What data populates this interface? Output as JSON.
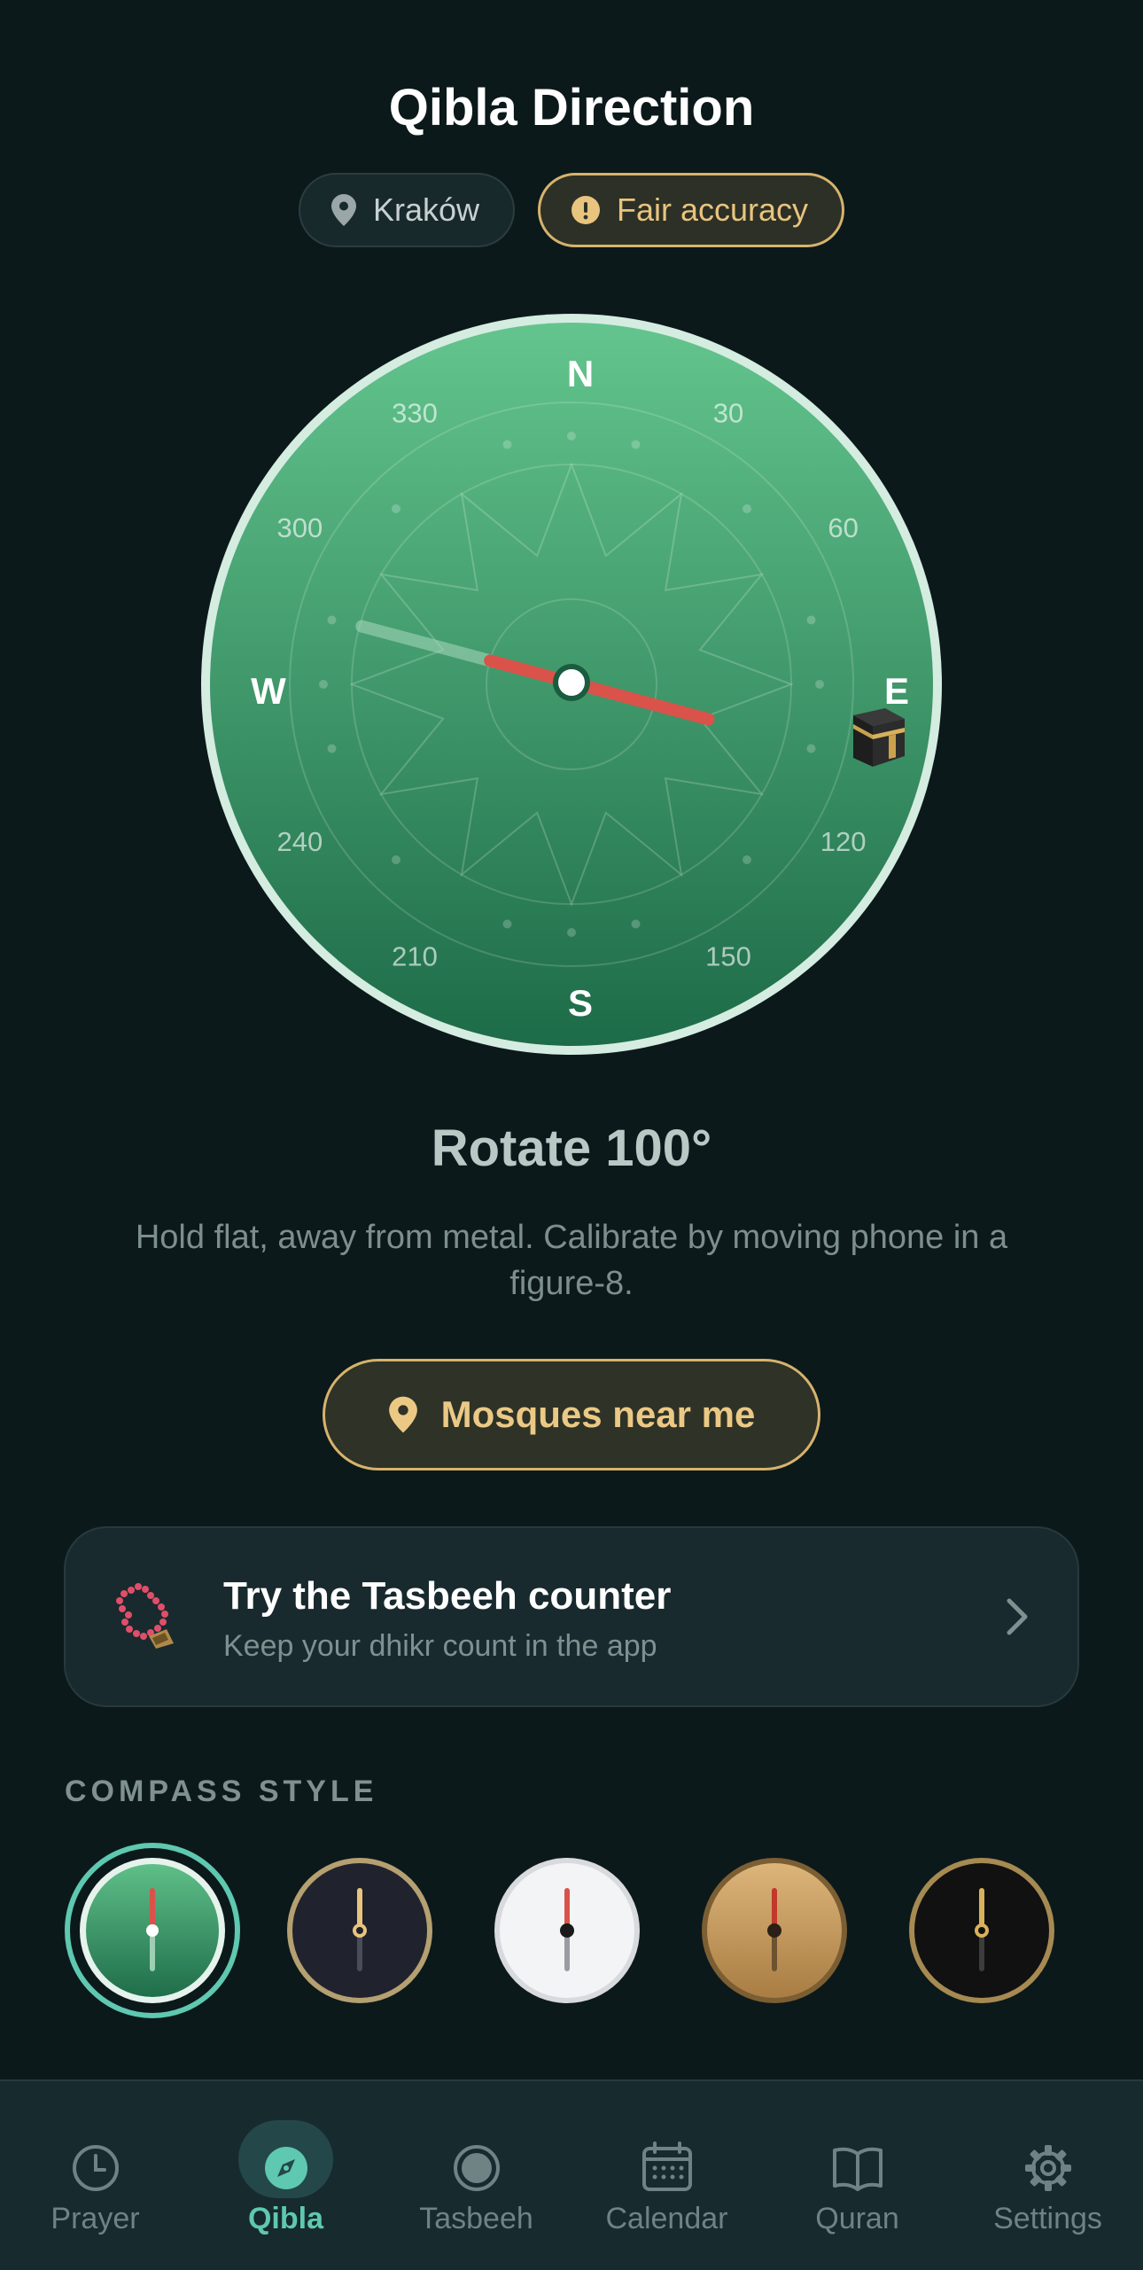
{
  "header": {
    "title": "Qibla Direction",
    "location_chip": "Kraków",
    "accuracy_chip": "Fair accuracy"
  },
  "compass": {
    "cardinals": {
      "n": "N",
      "e": "E",
      "s": "S",
      "w": "W"
    },
    "degree_labels": [
      "30",
      "60",
      "120",
      "150",
      "210",
      "240",
      "300",
      "330"
    ],
    "needle_heading_deg": 105,
    "qibla_marker_icon": "kaaba-icon",
    "colors": {
      "face_top": "#62c48c",
      "face_bottom": "#1f6e4a",
      "rim": "#d5ece1",
      "needle": "#d9534a"
    }
  },
  "instruction": {
    "rotate": "Rotate 100°",
    "hint": "Hold flat, away from metal. Calibrate by moving phone in a figure-8."
  },
  "mosques_button": {
    "label": "Mosques near me",
    "icon": "location-pin-icon"
  },
  "tasbeeh_card": {
    "title": "Try the Tasbeeh counter",
    "subtitle": "Keep your dhikr count in the app",
    "icon": "prayer-beads-icon"
  },
  "compass_style": {
    "heading": "COMPASS STYLE",
    "selected_index": 0,
    "options": [
      {
        "id": "green",
        "face": "#3f9a6b",
        "rim": "#e6f3ec"
      },
      {
        "id": "navy",
        "face": "#20232e",
        "rim": "#b5a071"
      },
      {
        "id": "white",
        "face": "#f3f4f6",
        "rim": "#d9dadd"
      },
      {
        "id": "gold",
        "face": "#c69a5d",
        "rim": "#8a6a3c"
      },
      {
        "id": "black",
        "face": "#111111",
        "rim": "#a68a52"
      }
    ]
  },
  "tabbar": {
    "active": "qibla",
    "tabs": [
      {
        "id": "prayer",
        "label": "Prayer",
        "icon": "clock-icon"
      },
      {
        "id": "qibla",
        "label": "Qibla",
        "icon": "compass-icon"
      },
      {
        "id": "tasbeeh",
        "label": "Tasbeeh",
        "icon": "tasbeeh-icon"
      },
      {
        "id": "calendar",
        "label": "Calendar",
        "icon": "calendar-icon"
      },
      {
        "id": "quran",
        "label": "Quran",
        "icon": "book-icon"
      },
      {
        "id": "settings",
        "label": "Settings",
        "icon": "gear-icon"
      }
    ]
  }
}
